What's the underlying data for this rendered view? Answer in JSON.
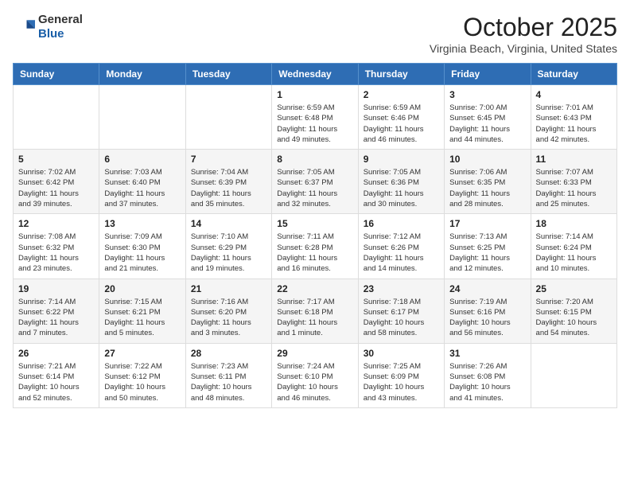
{
  "header": {
    "logo_line1": "General",
    "logo_line2": "Blue",
    "month": "October 2025",
    "location": "Virginia Beach, Virginia, United States"
  },
  "weekdays": [
    "Sunday",
    "Monday",
    "Tuesday",
    "Wednesday",
    "Thursday",
    "Friday",
    "Saturday"
  ],
  "weeks": [
    [
      {
        "day": "",
        "info": ""
      },
      {
        "day": "",
        "info": ""
      },
      {
        "day": "",
        "info": ""
      },
      {
        "day": "1",
        "info": "Sunrise: 6:59 AM\nSunset: 6:48 PM\nDaylight: 11 hours\nand 49 minutes."
      },
      {
        "day": "2",
        "info": "Sunrise: 6:59 AM\nSunset: 6:46 PM\nDaylight: 11 hours\nand 46 minutes."
      },
      {
        "day": "3",
        "info": "Sunrise: 7:00 AM\nSunset: 6:45 PM\nDaylight: 11 hours\nand 44 minutes."
      },
      {
        "day": "4",
        "info": "Sunrise: 7:01 AM\nSunset: 6:43 PM\nDaylight: 11 hours\nand 42 minutes."
      }
    ],
    [
      {
        "day": "5",
        "info": "Sunrise: 7:02 AM\nSunset: 6:42 PM\nDaylight: 11 hours\nand 39 minutes."
      },
      {
        "day": "6",
        "info": "Sunrise: 7:03 AM\nSunset: 6:40 PM\nDaylight: 11 hours\nand 37 minutes."
      },
      {
        "day": "7",
        "info": "Sunrise: 7:04 AM\nSunset: 6:39 PM\nDaylight: 11 hours\nand 35 minutes."
      },
      {
        "day": "8",
        "info": "Sunrise: 7:05 AM\nSunset: 6:37 PM\nDaylight: 11 hours\nand 32 minutes."
      },
      {
        "day": "9",
        "info": "Sunrise: 7:05 AM\nSunset: 6:36 PM\nDaylight: 11 hours\nand 30 minutes."
      },
      {
        "day": "10",
        "info": "Sunrise: 7:06 AM\nSunset: 6:35 PM\nDaylight: 11 hours\nand 28 minutes."
      },
      {
        "day": "11",
        "info": "Sunrise: 7:07 AM\nSunset: 6:33 PM\nDaylight: 11 hours\nand 25 minutes."
      }
    ],
    [
      {
        "day": "12",
        "info": "Sunrise: 7:08 AM\nSunset: 6:32 PM\nDaylight: 11 hours\nand 23 minutes."
      },
      {
        "day": "13",
        "info": "Sunrise: 7:09 AM\nSunset: 6:30 PM\nDaylight: 11 hours\nand 21 minutes."
      },
      {
        "day": "14",
        "info": "Sunrise: 7:10 AM\nSunset: 6:29 PM\nDaylight: 11 hours\nand 19 minutes."
      },
      {
        "day": "15",
        "info": "Sunrise: 7:11 AM\nSunset: 6:28 PM\nDaylight: 11 hours\nand 16 minutes."
      },
      {
        "day": "16",
        "info": "Sunrise: 7:12 AM\nSunset: 6:26 PM\nDaylight: 11 hours\nand 14 minutes."
      },
      {
        "day": "17",
        "info": "Sunrise: 7:13 AM\nSunset: 6:25 PM\nDaylight: 11 hours\nand 12 minutes."
      },
      {
        "day": "18",
        "info": "Sunrise: 7:14 AM\nSunset: 6:24 PM\nDaylight: 11 hours\nand 10 minutes."
      }
    ],
    [
      {
        "day": "19",
        "info": "Sunrise: 7:14 AM\nSunset: 6:22 PM\nDaylight: 11 hours\nand 7 minutes."
      },
      {
        "day": "20",
        "info": "Sunrise: 7:15 AM\nSunset: 6:21 PM\nDaylight: 11 hours\nand 5 minutes."
      },
      {
        "day": "21",
        "info": "Sunrise: 7:16 AM\nSunset: 6:20 PM\nDaylight: 11 hours\nand 3 minutes."
      },
      {
        "day": "22",
        "info": "Sunrise: 7:17 AM\nSunset: 6:18 PM\nDaylight: 11 hours\nand 1 minute."
      },
      {
        "day": "23",
        "info": "Sunrise: 7:18 AM\nSunset: 6:17 PM\nDaylight: 10 hours\nand 58 minutes."
      },
      {
        "day": "24",
        "info": "Sunrise: 7:19 AM\nSunset: 6:16 PM\nDaylight: 10 hours\nand 56 minutes."
      },
      {
        "day": "25",
        "info": "Sunrise: 7:20 AM\nSunset: 6:15 PM\nDaylight: 10 hours\nand 54 minutes."
      }
    ],
    [
      {
        "day": "26",
        "info": "Sunrise: 7:21 AM\nSunset: 6:14 PM\nDaylight: 10 hours\nand 52 minutes."
      },
      {
        "day": "27",
        "info": "Sunrise: 7:22 AM\nSunset: 6:12 PM\nDaylight: 10 hours\nand 50 minutes."
      },
      {
        "day": "28",
        "info": "Sunrise: 7:23 AM\nSunset: 6:11 PM\nDaylight: 10 hours\nand 48 minutes."
      },
      {
        "day": "29",
        "info": "Sunrise: 7:24 AM\nSunset: 6:10 PM\nDaylight: 10 hours\nand 46 minutes."
      },
      {
        "day": "30",
        "info": "Sunrise: 7:25 AM\nSunset: 6:09 PM\nDaylight: 10 hours\nand 43 minutes."
      },
      {
        "day": "31",
        "info": "Sunrise: 7:26 AM\nSunset: 6:08 PM\nDaylight: 10 hours\nand 41 minutes."
      },
      {
        "day": "",
        "info": ""
      }
    ]
  ]
}
